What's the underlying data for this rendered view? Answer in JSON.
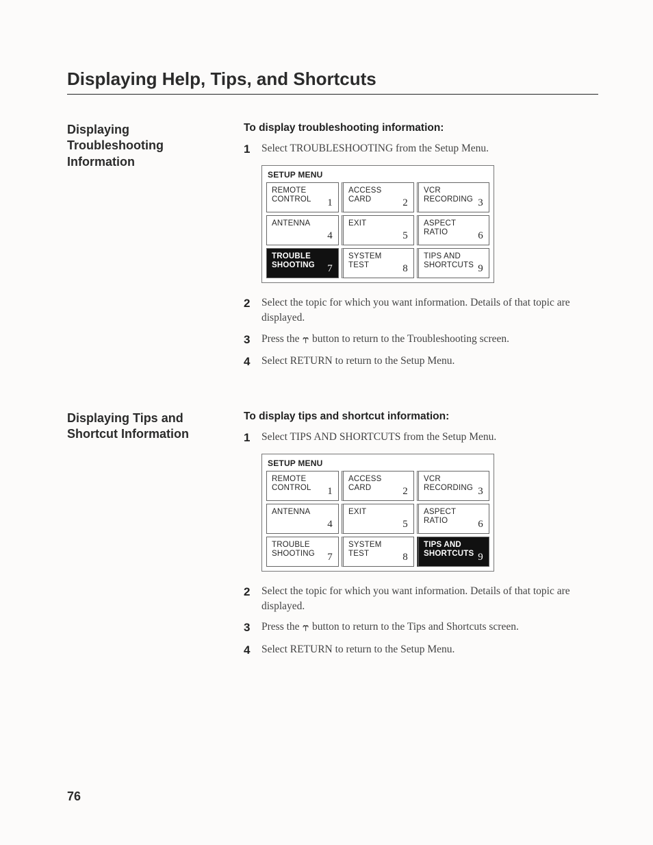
{
  "page_title": "Displaying Help, Tips, and Shortcuts",
  "page_number": "76",
  "section1": {
    "left_heading": "Displaying Troubleshooting Information",
    "instr_heading": "To display troubleshooting information:",
    "steps": {
      "s1": "Select TROUBLESHOOTING from the Setup Menu.",
      "s2": "Select the topic for which you want information. Details of that topic are displayed.",
      "s3_a": "Press the ",
      "s3_b": " button to return to the Troubleshooting screen.",
      "s4": "Select RETURN to return to the Setup Menu."
    },
    "menu_title": "SETUP MENU",
    "cells": [
      {
        "label": "REMOTE\nCONTROL",
        "num": "1"
      },
      {
        "label": "ACCESS\nCARD",
        "num": "2"
      },
      {
        "label": "VCR\nRECORDING",
        "num": "3"
      },
      {
        "label": "ANTENNA",
        "num": "4"
      },
      {
        "label": "EXIT",
        "num": "5"
      },
      {
        "label": "ASPECT\nRATIO",
        "num": "6"
      },
      {
        "label": "TROUBLE\nSHOOTING",
        "num": "7",
        "selected": true
      },
      {
        "label": "SYSTEM\nTEST",
        "num": "8"
      },
      {
        "label": "TIPS AND\nSHORTCUTS",
        "num": "9"
      }
    ]
  },
  "section2": {
    "left_heading": "Displaying Tips and Shortcut Information",
    "instr_heading": "To display tips and shortcut information:",
    "steps": {
      "s1": "Select TIPS AND SHORTCUTS from the Setup Menu.",
      "s2": "Select the topic for which you want information. Details of that topic are displayed.",
      "s3_a": "Press the ",
      "s3_b": " button to return to the Tips and Shortcuts screen.",
      "s4": "Select RETURN to return to the Setup Menu."
    },
    "menu_title": "SETUP MENU",
    "cells": [
      {
        "label": "REMOTE\nCONTROL",
        "num": "1"
      },
      {
        "label": "ACCESS\nCARD",
        "num": "2"
      },
      {
        "label": "VCR\nRECORDING",
        "num": "3"
      },
      {
        "label": "ANTENNA",
        "num": "4"
      },
      {
        "label": "EXIT",
        "num": "5"
      },
      {
        "label": "ASPECT\nRATIO",
        "num": "6"
      },
      {
        "label": "TROUBLE\nSHOOTING",
        "num": "7"
      },
      {
        "label": "SYSTEM\nTEST",
        "num": "8"
      },
      {
        "label": "TIPS AND\nSHORTCUTS",
        "num": "9",
        "selected": true
      }
    ]
  }
}
